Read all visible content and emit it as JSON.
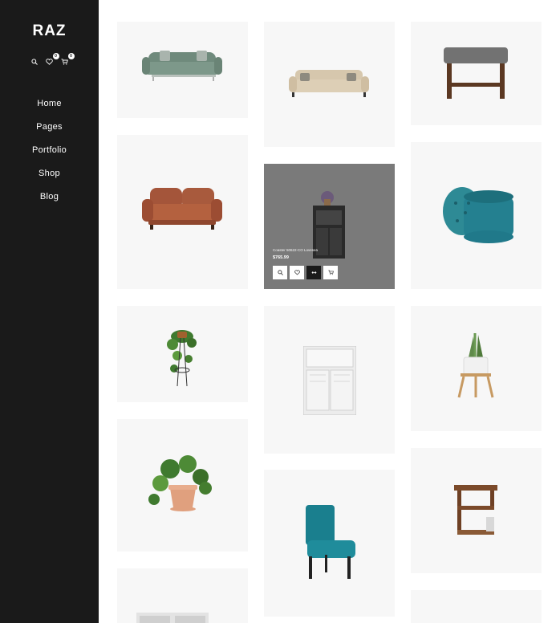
{
  "brand": {
    "logo": "RAZ"
  },
  "header_icons": {
    "search": "search-icon",
    "wishlist": {
      "icon": "heart-icon",
      "count": "0"
    },
    "cart": {
      "icon": "cart-icon",
      "count": "0"
    }
  },
  "nav": {
    "items": [
      "Home",
      "Pages",
      "Portfolio",
      "Shop",
      "Blog"
    ]
  },
  "featured_product": {
    "name": "Coaster 50622-CO Lovesea",
    "price": "$765.99",
    "actions": [
      "search-icon",
      "heart-icon",
      "compare-icon",
      "cart-icon"
    ]
  },
  "colors": {
    "sidebar": "#1a1a1a",
    "card_bg": "#f7f7f7",
    "hover_overlay": "#7a7a7a"
  }
}
